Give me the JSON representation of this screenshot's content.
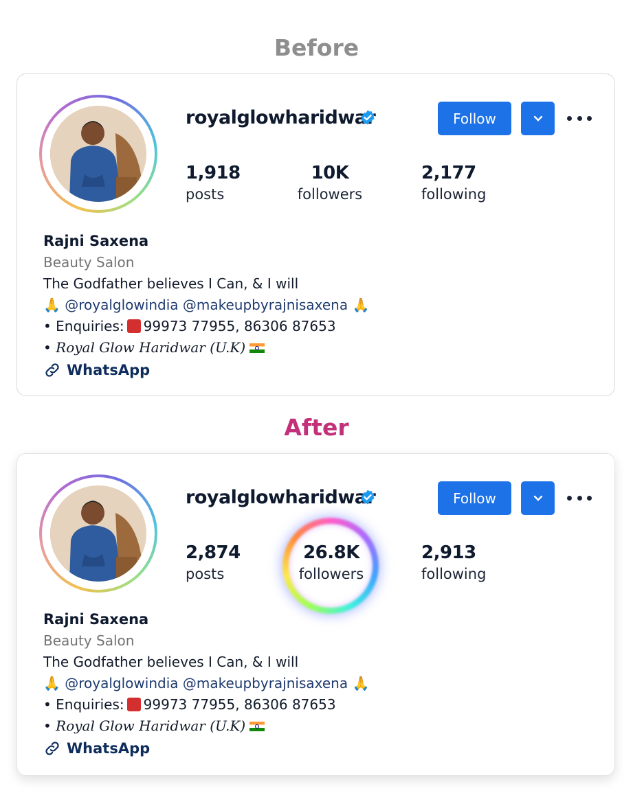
{
  "sections": {
    "before_label": "Before",
    "after_label": "After"
  },
  "colors": {
    "accent_blue": "#1d72e8",
    "before_label": "#8e8e8e",
    "after_label": "#c2307a"
  },
  "before": {
    "username": "royalglowharidwar",
    "follow_label": "Follow",
    "stats": {
      "posts_count": "1,918",
      "posts_label": "posts",
      "followers_count": "10K",
      "followers_label": "followers",
      "following_count": "2,177",
      "following_label": "following"
    },
    "bio": {
      "name": "Rajni Saxena",
      "category": "Beauty Salon",
      "line1": "The Godfather believes I Can, & I will",
      "mentions": "@royalglowindia @makeupbyrajnisaxena",
      "enquiries_prefix": "• Enquiries:",
      "enquiries_numbers": "99973 77955, 86306 87653",
      "location": "• Royal Glow Haridwar (U.K)",
      "link": "WhatsApp"
    }
  },
  "after": {
    "username": "royalglowharidwar",
    "follow_label": "Follow",
    "stats": {
      "posts_count": "2,874",
      "posts_label": "posts",
      "followers_count": "26.8K",
      "followers_label": "followers",
      "following_count": "2,913",
      "following_label": "following"
    },
    "bio": {
      "name": "Rajni Saxena",
      "category": "Beauty Salon",
      "line1": "The Godfather believes I Can, & I will",
      "mentions": "@royalglowindia @makeupbyrajnisaxena",
      "enquiries_prefix": "• Enquiries:",
      "enquiries_numbers": "99973 77955, 86306 87653",
      "location": "• Royal Glow Haridwar (U.K)",
      "link": "WhatsApp"
    }
  },
  "icons": {
    "verified": "verified-badge-icon",
    "dropdown": "chevron-down-icon",
    "more": "more-dots-icon",
    "link": "link-icon",
    "pray": "folded-hands-icon",
    "phone": "telephone-icon",
    "flag": "india-flag-icon"
  }
}
